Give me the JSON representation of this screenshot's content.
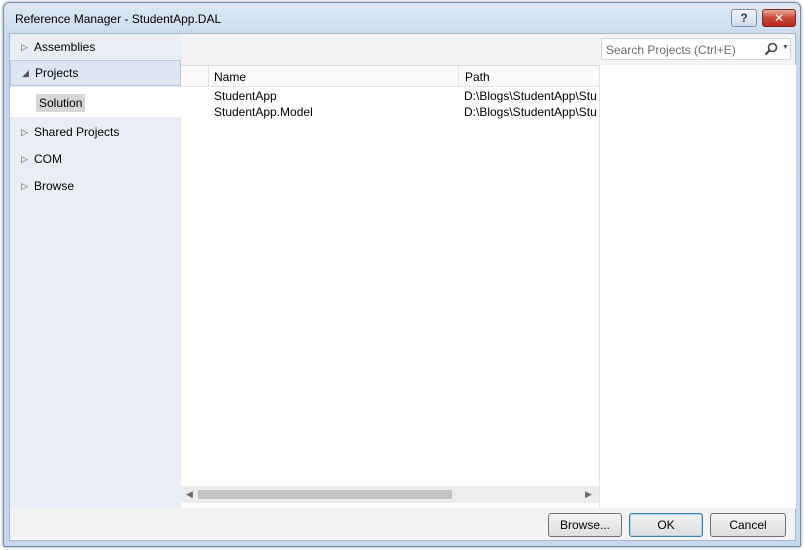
{
  "window": {
    "title": "Reference Manager - StudentApp.DAL"
  },
  "titlebar": {
    "help_label": "?",
    "close_label": "✕"
  },
  "nav": {
    "items": [
      {
        "label": "Assemblies",
        "expander": "▷"
      },
      {
        "label": "Projects",
        "expander": "◢"
      },
      {
        "label": "Shared Projects",
        "expander": "▷"
      },
      {
        "label": "COM",
        "expander": "▷"
      },
      {
        "label": "Browse",
        "expander": "▷"
      }
    ],
    "sub_selected": "Solution"
  },
  "search": {
    "placeholder": "Search Projects (Ctrl+E)",
    "icon": "search-icon"
  },
  "table": {
    "columns": [
      "Name",
      "Path"
    ],
    "rows": [
      {
        "name": "StudentApp",
        "path": "D:\\Blogs\\StudentApp\\Stu"
      },
      {
        "name": "StudentApp.Model",
        "path": "D:\\Blogs\\StudentApp\\Stu"
      }
    ]
  },
  "buttons": {
    "browse": "Browse...",
    "ok": "OK",
    "cancel": "Cancel"
  },
  "colors": {
    "accent": "#3c7fb1",
    "close": "#c9483a",
    "nav_bg": "#e9eef5"
  }
}
